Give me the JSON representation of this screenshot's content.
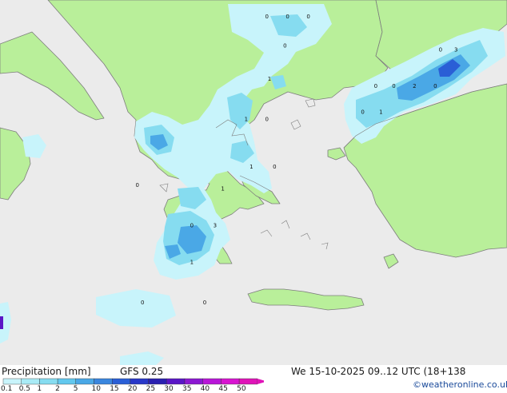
{
  "map": {
    "colors": {
      "sea": "#ebebeb",
      "land": "#b9ef9a",
      "coast": "#7d7d7d",
      "precip_light": "#c8f4fb",
      "precip_mid": "#86dcf0",
      "precip_strong": "#4aa8e6",
      "precip_heavy": "#2a5fd6"
    },
    "value_labels": [
      {
        "text": "0",
        "lon": 20.3,
        "lat": 42.7
      },
      {
        "text": "0",
        "lon": 21.1,
        "lat": 42.7
      },
      {
        "text": "0",
        "lon": 21.9,
        "lat": 42.7
      },
      {
        "text": "0",
        "lon": 21.0,
        "lat": 41.9
      },
      {
        "text": "1",
        "lon": 20.4,
        "lat": 41.0
      },
      {
        "text": "1",
        "lon": 19.5,
        "lat": 39.9
      },
      {
        "text": "0",
        "lon": 20.3,
        "lat": 39.9
      },
      {
        "text": "0",
        "lon": 15.3,
        "lat": 38.1
      },
      {
        "text": "1",
        "lon": 19.7,
        "lat": 38.6
      },
      {
        "text": "0",
        "lon": 20.6,
        "lat": 38.6
      },
      {
        "text": "1",
        "lon": 18.6,
        "lat": 38.0
      },
      {
        "text": "0",
        "lon": 17.4,
        "lat": 37.0
      },
      {
        "text": "3",
        "lon": 18.3,
        "lat": 37.0
      },
      {
        "text": "1",
        "lon": 17.4,
        "lat": 36.0
      },
      {
        "text": "0",
        "lon": 15.5,
        "lat": 34.9
      },
      {
        "text": "0",
        "lon": 17.9,
        "lat": 34.9
      },
      {
        "text": "0",
        "lon": 24.5,
        "lat": 40.8
      },
      {
        "text": "0",
        "lon": 25.2,
        "lat": 40.8
      },
      {
        "text": "2",
        "lon": 26.0,
        "lat": 40.8
      },
      {
        "text": "0",
        "lon": 26.8,
        "lat": 40.8
      },
      {
        "text": "0",
        "lon": 27.0,
        "lat": 41.8
      },
      {
        "text": "3",
        "lon": 27.6,
        "lat": 41.8
      },
      {
        "text": "0",
        "lon": 24.0,
        "lat": 40.1
      },
      {
        "text": "1",
        "lon": 24.7,
        "lat": 40.1
      }
    ]
  },
  "footer": {
    "title": "Precipitation [mm]",
    "model": "GFS 0.25",
    "valid": "We 15-10-2025 09..12 UTC (18+138",
    "credit": "©weatheronline.co.uk",
    "legend": [
      {
        "label": "0.1",
        "color": "#c8f4fb"
      },
      {
        "label": "0.5",
        "color": "#a9ebf6"
      },
      {
        "label": "1",
        "color": "#86dcf0"
      },
      {
        "label": "2",
        "color": "#62c8ee"
      },
      {
        "label": "5",
        "color": "#4aa8e6"
      },
      {
        "label": "10",
        "color": "#3a86de"
      },
      {
        "label": "15",
        "color": "#2a5fd6"
      },
      {
        "label": "20",
        "color": "#2838c8"
      },
      {
        "label": "25",
        "color": "#2a20b0"
      },
      {
        "label": "30",
        "color": "#5a16c6"
      },
      {
        "label": "35",
        "color": "#8c18d2"
      },
      {
        "label": "40",
        "color": "#b816d8"
      },
      {
        "label": "45",
        "color": "#d814d0"
      },
      {
        "label": "50",
        "color": "#e014b8"
      }
    ]
  }
}
